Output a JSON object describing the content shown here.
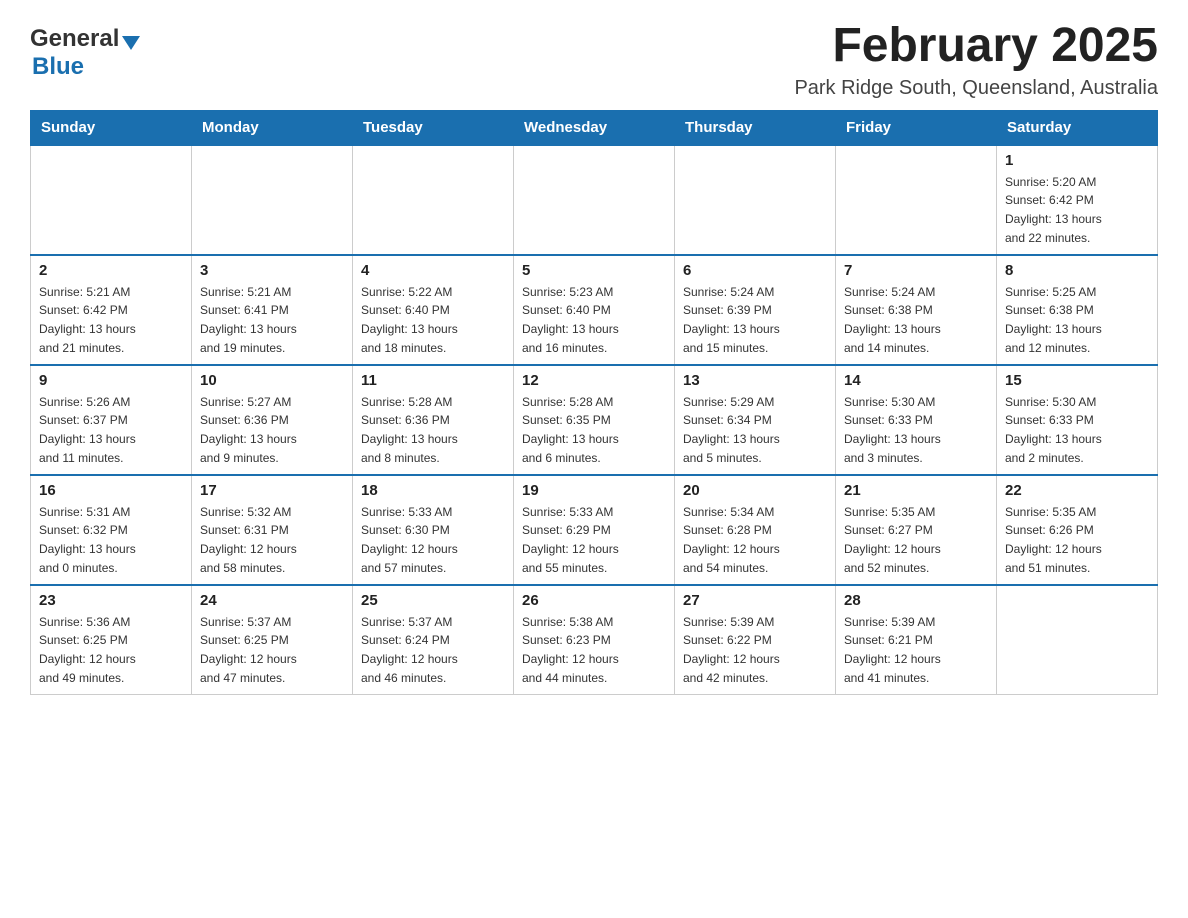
{
  "header": {
    "logo_general": "General",
    "logo_blue": "Blue",
    "month_title": "February 2025",
    "location": "Park Ridge South, Queensland, Australia"
  },
  "weekdays": [
    "Sunday",
    "Monday",
    "Tuesday",
    "Wednesday",
    "Thursday",
    "Friday",
    "Saturday"
  ],
  "weeks": [
    [
      {
        "day": "",
        "info": ""
      },
      {
        "day": "",
        "info": ""
      },
      {
        "day": "",
        "info": ""
      },
      {
        "day": "",
        "info": ""
      },
      {
        "day": "",
        "info": ""
      },
      {
        "day": "",
        "info": ""
      },
      {
        "day": "1",
        "info": "Sunrise: 5:20 AM\nSunset: 6:42 PM\nDaylight: 13 hours\nand 22 minutes."
      }
    ],
    [
      {
        "day": "2",
        "info": "Sunrise: 5:21 AM\nSunset: 6:42 PM\nDaylight: 13 hours\nand 21 minutes."
      },
      {
        "day": "3",
        "info": "Sunrise: 5:21 AM\nSunset: 6:41 PM\nDaylight: 13 hours\nand 19 minutes."
      },
      {
        "day": "4",
        "info": "Sunrise: 5:22 AM\nSunset: 6:40 PM\nDaylight: 13 hours\nand 18 minutes."
      },
      {
        "day": "5",
        "info": "Sunrise: 5:23 AM\nSunset: 6:40 PM\nDaylight: 13 hours\nand 16 minutes."
      },
      {
        "day": "6",
        "info": "Sunrise: 5:24 AM\nSunset: 6:39 PM\nDaylight: 13 hours\nand 15 minutes."
      },
      {
        "day": "7",
        "info": "Sunrise: 5:24 AM\nSunset: 6:38 PM\nDaylight: 13 hours\nand 14 minutes."
      },
      {
        "day": "8",
        "info": "Sunrise: 5:25 AM\nSunset: 6:38 PM\nDaylight: 13 hours\nand 12 minutes."
      }
    ],
    [
      {
        "day": "9",
        "info": "Sunrise: 5:26 AM\nSunset: 6:37 PM\nDaylight: 13 hours\nand 11 minutes."
      },
      {
        "day": "10",
        "info": "Sunrise: 5:27 AM\nSunset: 6:36 PM\nDaylight: 13 hours\nand 9 minutes."
      },
      {
        "day": "11",
        "info": "Sunrise: 5:28 AM\nSunset: 6:36 PM\nDaylight: 13 hours\nand 8 minutes."
      },
      {
        "day": "12",
        "info": "Sunrise: 5:28 AM\nSunset: 6:35 PM\nDaylight: 13 hours\nand 6 minutes."
      },
      {
        "day": "13",
        "info": "Sunrise: 5:29 AM\nSunset: 6:34 PM\nDaylight: 13 hours\nand 5 minutes."
      },
      {
        "day": "14",
        "info": "Sunrise: 5:30 AM\nSunset: 6:33 PM\nDaylight: 13 hours\nand 3 minutes."
      },
      {
        "day": "15",
        "info": "Sunrise: 5:30 AM\nSunset: 6:33 PM\nDaylight: 13 hours\nand 2 minutes."
      }
    ],
    [
      {
        "day": "16",
        "info": "Sunrise: 5:31 AM\nSunset: 6:32 PM\nDaylight: 13 hours\nand 0 minutes."
      },
      {
        "day": "17",
        "info": "Sunrise: 5:32 AM\nSunset: 6:31 PM\nDaylight: 12 hours\nand 58 minutes."
      },
      {
        "day": "18",
        "info": "Sunrise: 5:33 AM\nSunset: 6:30 PM\nDaylight: 12 hours\nand 57 minutes."
      },
      {
        "day": "19",
        "info": "Sunrise: 5:33 AM\nSunset: 6:29 PM\nDaylight: 12 hours\nand 55 minutes."
      },
      {
        "day": "20",
        "info": "Sunrise: 5:34 AM\nSunset: 6:28 PM\nDaylight: 12 hours\nand 54 minutes."
      },
      {
        "day": "21",
        "info": "Sunrise: 5:35 AM\nSunset: 6:27 PM\nDaylight: 12 hours\nand 52 minutes."
      },
      {
        "day": "22",
        "info": "Sunrise: 5:35 AM\nSunset: 6:26 PM\nDaylight: 12 hours\nand 51 minutes."
      }
    ],
    [
      {
        "day": "23",
        "info": "Sunrise: 5:36 AM\nSunset: 6:25 PM\nDaylight: 12 hours\nand 49 minutes."
      },
      {
        "day": "24",
        "info": "Sunrise: 5:37 AM\nSunset: 6:25 PM\nDaylight: 12 hours\nand 47 minutes."
      },
      {
        "day": "25",
        "info": "Sunrise: 5:37 AM\nSunset: 6:24 PM\nDaylight: 12 hours\nand 46 minutes."
      },
      {
        "day": "26",
        "info": "Sunrise: 5:38 AM\nSunset: 6:23 PM\nDaylight: 12 hours\nand 44 minutes."
      },
      {
        "day": "27",
        "info": "Sunrise: 5:39 AM\nSunset: 6:22 PM\nDaylight: 12 hours\nand 42 minutes."
      },
      {
        "day": "28",
        "info": "Sunrise: 5:39 AM\nSunset: 6:21 PM\nDaylight: 12 hours\nand 41 minutes."
      },
      {
        "day": "",
        "info": ""
      }
    ]
  ]
}
